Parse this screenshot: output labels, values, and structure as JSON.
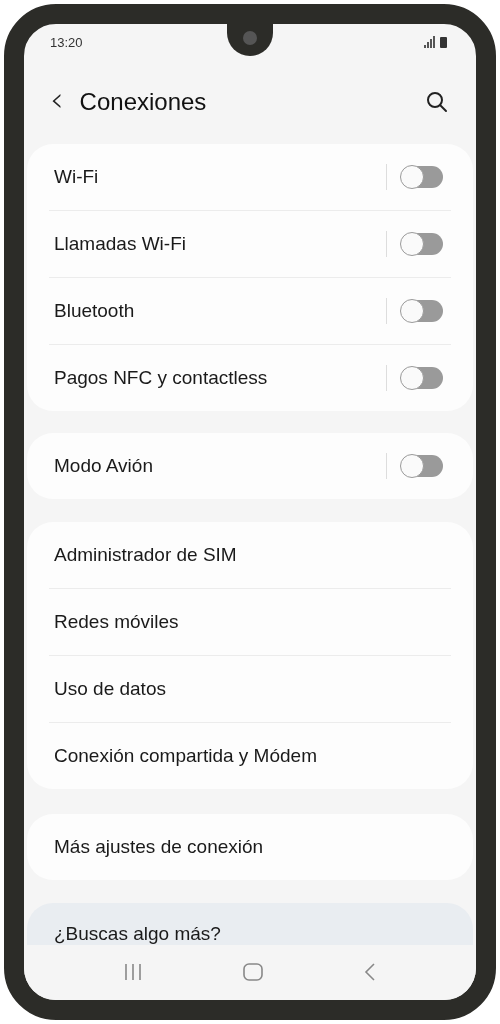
{
  "status_bar": {
    "time": "13:20"
  },
  "header": {
    "back": "‹",
    "title": "Conexiones"
  },
  "groups": [
    {
      "items": [
        {
          "kind": "toggle",
          "label": "Wi-Fi",
          "on": false
        },
        {
          "kind": "toggle",
          "label": "Llamadas Wi-Fi",
          "on": false
        },
        {
          "kind": "toggle",
          "label": "Bluetooth",
          "on": false
        },
        {
          "kind": "toggle",
          "label": "Pagos NFC y contactless",
          "on": false
        }
      ]
    },
    {
      "items": [
        {
          "kind": "toggle",
          "label": "Modo Avión",
          "on": false
        }
      ]
    },
    {
      "items": [
        {
          "kind": "link",
          "label": "Administrador de SIM"
        },
        {
          "kind": "link",
          "label": "Redes móviles"
        },
        {
          "kind": "link",
          "label": "Uso de datos"
        },
        {
          "kind": "link",
          "label": "Conexión compartida y Módem"
        }
      ]
    },
    {
      "items": [
        {
          "kind": "link",
          "label": "Más ajustes de conexión"
        }
      ]
    }
  ],
  "suggestion": {
    "title": "¿Buscas algo más?"
  }
}
